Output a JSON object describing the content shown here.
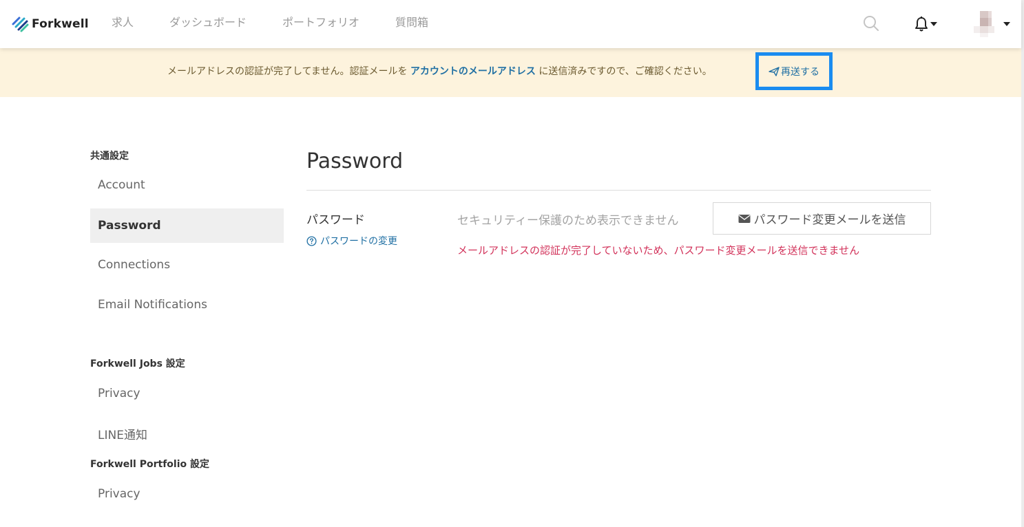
{
  "header": {
    "logo_text": "Forkwell",
    "nav": [
      {
        "label": "求人"
      },
      {
        "label": "ダッシュボード"
      },
      {
        "label": "ポートフォリオ"
      },
      {
        "label": "質問箱"
      }
    ],
    "icons": [
      "search-icon",
      "bell-icon",
      "caret-down-icon",
      "avatar"
    ]
  },
  "banner": {
    "text_before": "メールアドレスの認証が完了してません。認証メールを ",
    "link_text": "アカウントのメールアドレス",
    "text_after": " に送信済みですので、ご確認ください。",
    "resend_label": "再送する"
  },
  "sidebar": {
    "sections": [
      {
        "title": "共通設定",
        "items": [
          {
            "label": "Account"
          },
          {
            "label": "Password",
            "active": true
          },
          {
            "label": "Connections"
          },
          {
            "label": "Email Notifications"
          }
        ]
      },
      {
        "title": "Forkwell Jobs 設定",
        "items": [
          {
            "label": "Privacy"
          },
          {
            "label": "LINE通知"
          }
        ]
      },
      {
        "title": "Forkwell Portfolio 設定",
        "items": [
          {
            "label": "Privacy"
          }
        ]
      }
    ]
  },
  "main": {
    "title": "Password",
    "row_label": "パスワード",
    "help_link": "パスワードの変更",
    "masked_text": "セキュリティー保護のため表示できません",
    "send_button": "パスワード変更メールを送信",
    "error_text": "メールアドレスの認証が完了していないため、パスワード変更メールを送信できません"
  },
  "colors": {
    "accent_link": "#1f6fa3",
    "banner_bg": "#fdf3dd",
    "error": "#d2325a",
    "highlight_border": "#1a8cf0"
  }
}
